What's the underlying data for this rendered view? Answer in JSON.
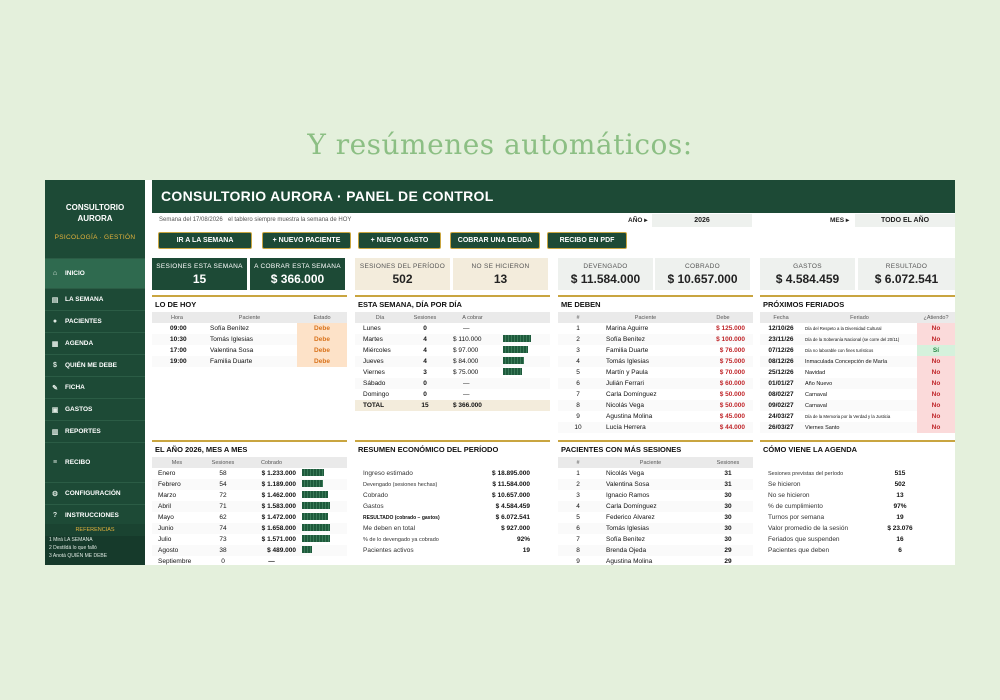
{
  "headline": "Y resúmenes automáticos:",
  "sidebar": {
    "title": "CONSULTORIO AURORA",
    "subtitle": "PSICOLOGÍA · GESTIÓN",
    "items": [
      {
        "label": "INICIO",
        "icon": "home-icon"
      },
      {
        "label": "LA SEMANA",
        "icon": "calendar-week-icon"
      },
      {
        "label": "PACIENTES",
        "icon": "person-icon"
      },
      {
        "label": "AGENDA",
        "icon": "calendar-icon"
      },
      {
        "label": "QUIÉN ME DEBE",
        "icon": "money-bag-icon"
      },
      {
        "label": "FICHA",
        "icon": "chat-icon"
      },
      {
        "label": "GASTOS",
        "icon": "document-icon"
      },
      {
        "label": "REPORTES",
        "icon": "chart-icon"
      },
      {
        "label": "RECIBO",
        "icon": "receipt-icon"
      },
      {
        "label": "CONFIGURACIÓN",
        "icon": "gear-icon"
      },
      {
        "label": "INSTRUCCIONES",
        "icon": "question-icon"
      }
    ],
    "refs_title": "REFERENCIAS",
    "refs": [
      "1 Mirá LA SEMANA",
      "2 Destildá lo que falló",
      "3 Anotá QUIÉN ME DEBE"
    ]
  },
  "header": {
    "title": "CONSULTORIO AURORA · PANEL DE CONTROL",
    "week_note": "Semana del 17/08/2026",
    "note": "el tablero siempre muestra la semana de HOY",
    "year_label": "AÑO",
    "year_value": "2026",
    "month_label": "MES",
    "month_value": "TODO EL AÑO"
  },
  "buttons": [
    "IR A LA SEMANA",
    "+ NUEVO PACIENTE",
    "+ NUEVO GASTO",
    "COBRAR UNA DEUDA",
    "RECIBO EN PDF"
  ],
  "kpis": [
    {
      "label": "SESIONES ESTA SEMANA",
      "value": "15"
    },
    {
      "label": "A COBRAR ESTA SEMANA",
      "value": "$ 366.000"
    },
    {
      "label": "SESIONES DEL PERÍODO",
      "value": "502"
    },
    {
      "label": "NO SE HICIERON",
      "value": "13"
    },
    {
      "label": "DEVENGADO",
      "value": "$ 11.584.000"
    },
    {
      "label": "COBRADO",
      "value": "$ 10.657.000"
    },
    {
      "label": "GASTOS",
      "value": "$ 4.584.459"
    },
    {
      "label": "RESULTADO",
      "value": "$ 6.072.541"
    }
  ],
  "today": {
    "title": "LO DE HOY",
    "headers": [
      "Hora",
      "Paciente",
      "Estado"
    ],
    "rows": [
      [
        "09:00",
        "Sofía Benítez",
        "Debe"
      ],
      [
        "10:30",
        "Tomás Iglesias",
        "Debe"
      ],
      [
        "17:00",
        "Valentina Sosa",
        "Debe"
      ],
      [
        "19:00",
        "Familia Duarte",
        "Debe"
      ]
    ]
  },
  "week": {
    "title": "ESTA SEMANA, DÍA POR DÍA",
    "headers": [
      "Día",
      "Sesiones",
      "A cobrar"
    ],
    "rows": [
      {
        "day": "Lunes",
        "sessions": "0",
        "amount": "—",
        "bar": 0
      },
      {
        "day": "Martes",
        "sessions": "4",
        "amount": "$ 110.000",
        "bar": 1
      },
      {
        "day": "Miércoles",
        "sessions": "4",
        "amount": "$ 97.000",
        "bar": 0.88
      },
      {
        "day": "Jueves",
        "sessions": "4",
        "amount": "$ 84.000",
        "bar": 0.76
      },
      {
        "day": "Viernes",
        "sessions": "3",
        "amount": "$ 75.000",
        "bar": 0.68
      },
      {
        "day": "Sábado",
        "sessions": "0",
        "amount": "—",
        "bar": 0
      },
      {
        "day": "Domingo",
        "sessions": "0",
        "amount": "—",
        "bar": 0
      }
    ],
    "total": {
      "day": "TOTAL",
      "sessions": "15",
      "amount": "$ 366.000"
    }
  },
  "debts": {
    "title": "ME DEBEN",
    "headers": [
      "#",
      "Paciente",
      "Debe"
    ],
    "rows": [
      [
        "1",
        "Marina Aguirre",
        "$ 125.000"
      ],
      [
        "2",
        "Sofía Benítez",
        "$ 100.000"
      ],
      [
        "3",
        "Familia Duarte",
        "$ 76.000"
      ],
      [
        "4",
        "Tomás Iglesias",
        "$ 75.000"
      ],
      [
        "5",
        "Martín y Paula",
        "$ 70.000"
      ],
      [
        "6",
        "Julián Ferrari",
        "$ 60.000"
      ],
      [
        "7",
        "Carla Domínguez",
        "$ 50.000"
      ],
      [
        "8",
        "Nicolás Vega",
        "$ 50.000"
      ],
      [
        "9",
        "Agustina Molina",
        "$ 45.000"
      ],
      [
        "10",
        "Lucía Herrera",
        "$ 44.000"
      ]
    ]
  },
  "holidays": {
    "title": "PRÓXIMOS FERIADOS",
    "headers": [
      "Fecha",
      "Feriado",
      "¿Atiendo?"
    ],
    "rows": [
      [
        "12/10/26",
        "Día del Respeto a la Diversidad Cultural",
        "No"
      ],
      [
        "23/11/26",
        "Día de la Soberanía Nacional (se corre del 20/11)",
        "No"
      ],
      [
        "07/12/26",
        "Día no laborable con fines turísticos",
        "Sí"
      ],
      [
        "08/12/26",
        "Inmaculada Concepción de María",
        "No"
      ],
      [
        "25/12/26",
        "Navidad",
        "No"
      ],
      [
        "01/01/27",
        "Año Nuevo",
        "No"
      ],
      [
        "08/02/27",
        "Carnaval",
        "No"
      ],
      [
        "09/02/27",
        "Carnaval",
        "No"
      ],
      [
        "24/03/27",
        "Día de la Memoria por la Verdad y la Justicia",
        "No"
      ],
      [
        "26/03/27",
        "Viernes Santo",
        "No"
      ]
    ]
  },
  "months": {
    "title": "EL AÑO 2026, MES A MES",
    "headers": [
      "Mes",
      "Sesiones",
      "Cobrado"
    ],
    "rows": [
      {
        "m": "Enero",
        "s": "58",
        "c": "$ 1.233.000",
        "bar": 0.78
      },
      {
        "m": "Febrero",
        "s": "54",
        "c": "$ 1.189.000",
        "bar": 0.75
      },
      {
        "m": "Marzo",
        "s": "72",
        "c": "$ 1.462.000",
        "bar": 0.92
      },
      {
        "m": "Abril",
        "s": "71",
        "c": "$ 1.583.000",
        "bar": 1.0
      },
      {
        "m": "Mayo",
        "s": "62",
        "c": "$ 1.472.000",
        "bar": 0.93
      },
      {
        "m": "Junio",
        "s": "74",
        "c": "$ 1.658.000",
        "bar": 1.0
      },
      {
        "m": "Julio",
        "s": "73",
        "c": "$ 1.571.000",
        "bar": 0.99
      },
      {
        "m": "Agosto",
        "s": "38",
        "c": "$ 489.000",
        "bar": 0.35
      },
      {
        "m": "Septiembre",
        "s": "0",
        "c": "—",
        "bar": 0
      }
    ]
  },
  "summary": {
    "title": "RESUMEN ECONÓMICO DEL PERÍODO",
    "rows": [
      [
        "Ingreso estimado",
        "$ 18.895.000"
      ],
      [
        "Devengado (sesiones hechas)",
        "$ 11.584.000"
      ],
      [
        "Cobrado",
        "$ 10.657.000"
      ],
      [
        "Gastos",
        "$ 4.584.459"
      ],
      [
        "RESULTADO (cobrado − gastos)",
        "$ 6.072.541"
      ],
      [
        "Me deben en total",
        "$ 927.000"
      ],
      [
        "% de lo devengado ya cobrado",
        "92%"
      ],
      [
        "Pacientes activos",
        "19"
      ]
    ]
  },
  "top_patients": {
    "title": "PACIENTES CON MÁS SESIONES",
    "headers": [
      "#",
      "Paciente",
      "Sesiones"
    ],
    "rows": [
      [
        "1",
        "Nicolás Vega",
        "31"
      ],
      [
        "2",
        "Valentina Sosa",
        "31"
      ],
      [
        "3",
        "Ignacio Ramos",
        "30"
      ],
      [
        "4",
        "Carla Domínguez",
        "30"
      ],
      [
        "5",
        "Federico Álvarez",
        "30"
      ],
      [
        "6",
        "Tomás Iglesias",
        "30"
      ],
      [
        "7",
        "Sofía Benítez",
        "30"
      ],
      [
        "8",
        "Brenda Ojeda",
        "29"
      ],
      [
        "9",
        "Agustina Molina",
        "29"
      ]
    ]
  },
  "agenda": {
    "title": "CÓMO VIENE LA AGENDA",
    "rows": [
      [
        "Sesiones previstas del período",
        "515"
      ],
      [
        "Se hicieron",
        "502"
      ],
      [
        "No se hicieron",
        "13"
      ],
      [
        "% de cumplimiento",
        "97%"
      ],
      [
        "Turnos por semana",
        "19"
      ],
      [
        "Valor promedio de la sesión",
        "$ 23.076"
      ],
      [
        "Feriados que suspenden",
        "16"
      ],
      [
        "Pacientes que deben",
        "6"
      ]
    ]
  }
}
